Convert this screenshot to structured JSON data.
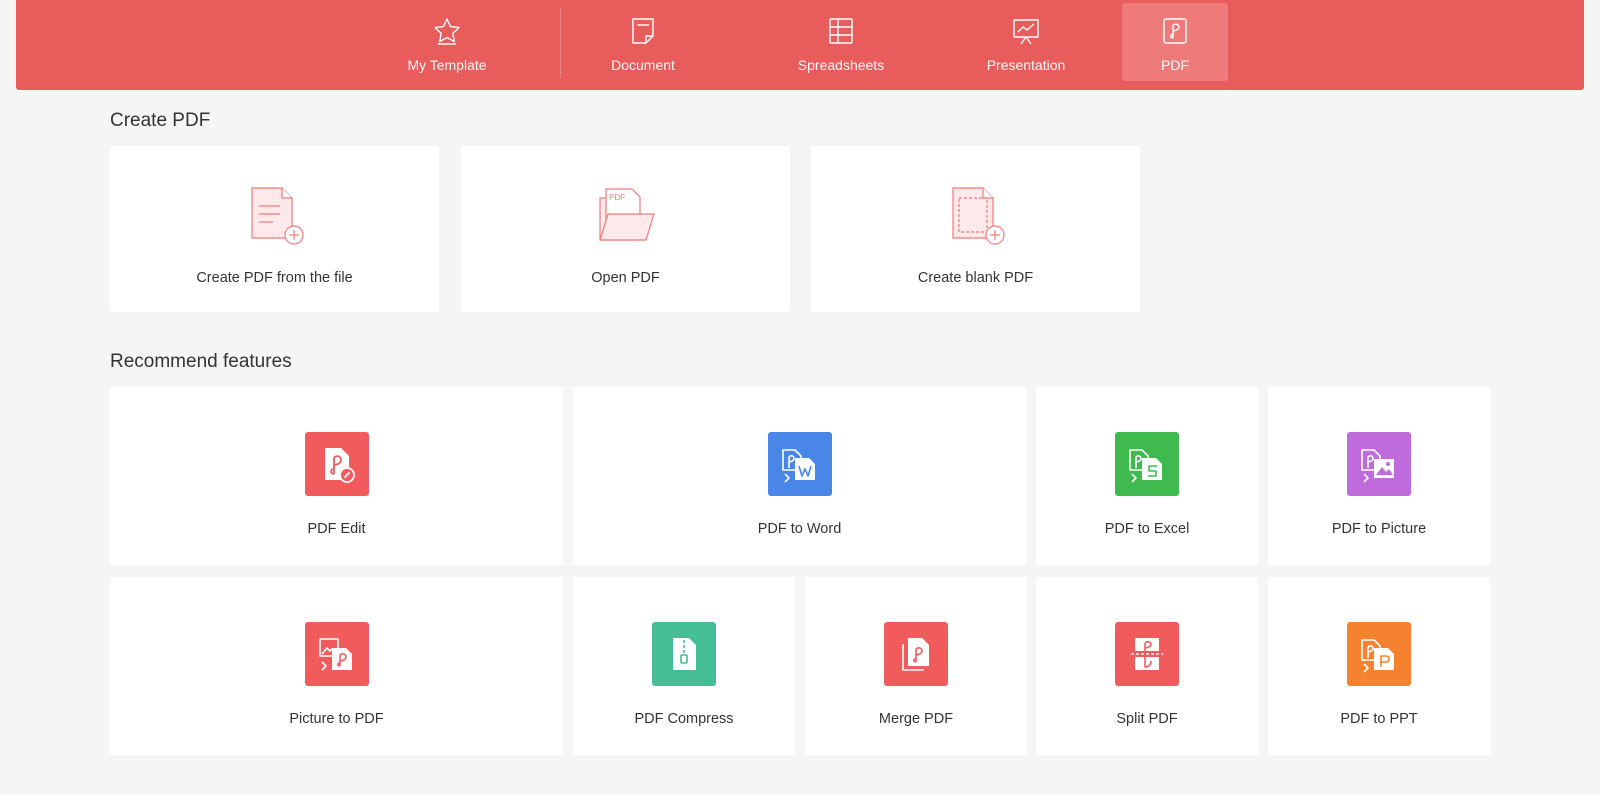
{
  "tabs": [
    {
      "label": "My Template",
      "icon": "star-icon"
    },
    {
      "label": "Document",
      "icon": "document-icon"
    },
    {
      "label": "Spreadsheets",
      "icon": "spreadsheet-icon"
    },
    {
      "label": "Presentation",
      "icon": "presentation-icon"
    },
    {
      "label": "PDF",
      "icon": "pdf-icon",
      "active": true
    }
  ],
  "create_section": {
    "title": "Create PDF",
    "cards": [
      {
        "label": "Create PDF from the file",
        "icon": "file-add-icon"
      },
      {
        "label": "Open PDF",
        "icon": "open-folder-icon",
        "icon_text": "PDF"
      },
      {
        "label": "Create blank PDF",
        "icon": "blank-file-add-icon"
      }
    ]
  },
  "features_section": {
    "title": "Recommend features",
    "items": [
      {
        "label": "PDF Edit",
        "icon": "pdf-edit-icon",
        "color": "#f25b5b"
      },
      {
        "label": "PDF to Word",
        "icon": "pdf-to-word-icon",
        "color": "#4a86e8"
      },
      {
        "label": "PDF to Excel",
        "icon": "pdf-to-excel-icon",
        "color": "#3fba4f"
      },
      {
        "label": "PDF to Picture",
        "icon": "pdf-to-picture-icon",
        "color": "#c06bdc"
      },
      {
        "label": "Picture to PDF",
        "icon": "picture-to-pdf-icon",
        "color": "#f25b5b"
      },
      {
        "label": "PDF Compress",
        "icon": "pdf-compress-icon",
        "color": "#45be96"
      },
      {
        "label": "Merge PDF",
        "icon": "merge-pdf-icon",
        "color": "#f25b5b"
      },
      {
        "label": "Split PDF",
        "icon": "split-pdf-icon",
        "color": "#f25b5b"
      },
      {
        "label": "PDF to PPT",
        "icon": "pdf-to-ppt-icon",
        "color": "#f5822e"
      }
    ]
  },
  "colors": {
    "accent": "#e95c5c",
    "accent_active": "#ef7a7a",
    "background": "#f5f5f5"
  }
}
